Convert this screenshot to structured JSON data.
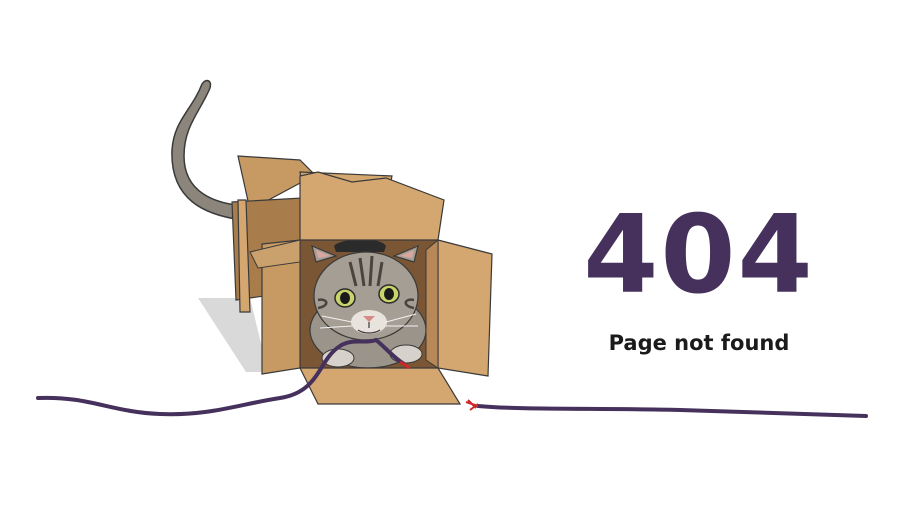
{
  "error": {
    "code": "404",
    "message": "Page not found"
  },
  "colors": {
    "accent": "#46315c",
    "text": "#1b1b1b",
    "cable": "#46315c",
    "box_light": "#d4a670",
    "box_dark": "#a97c4b",
    "cat_fur": "#9b948a",
    "background": "#ffffff"
  },
  "illustration": {
    "subject": "cat-in-cardboard-box-icon",
    "cable": "chewed-cable-icon"
  }
}
